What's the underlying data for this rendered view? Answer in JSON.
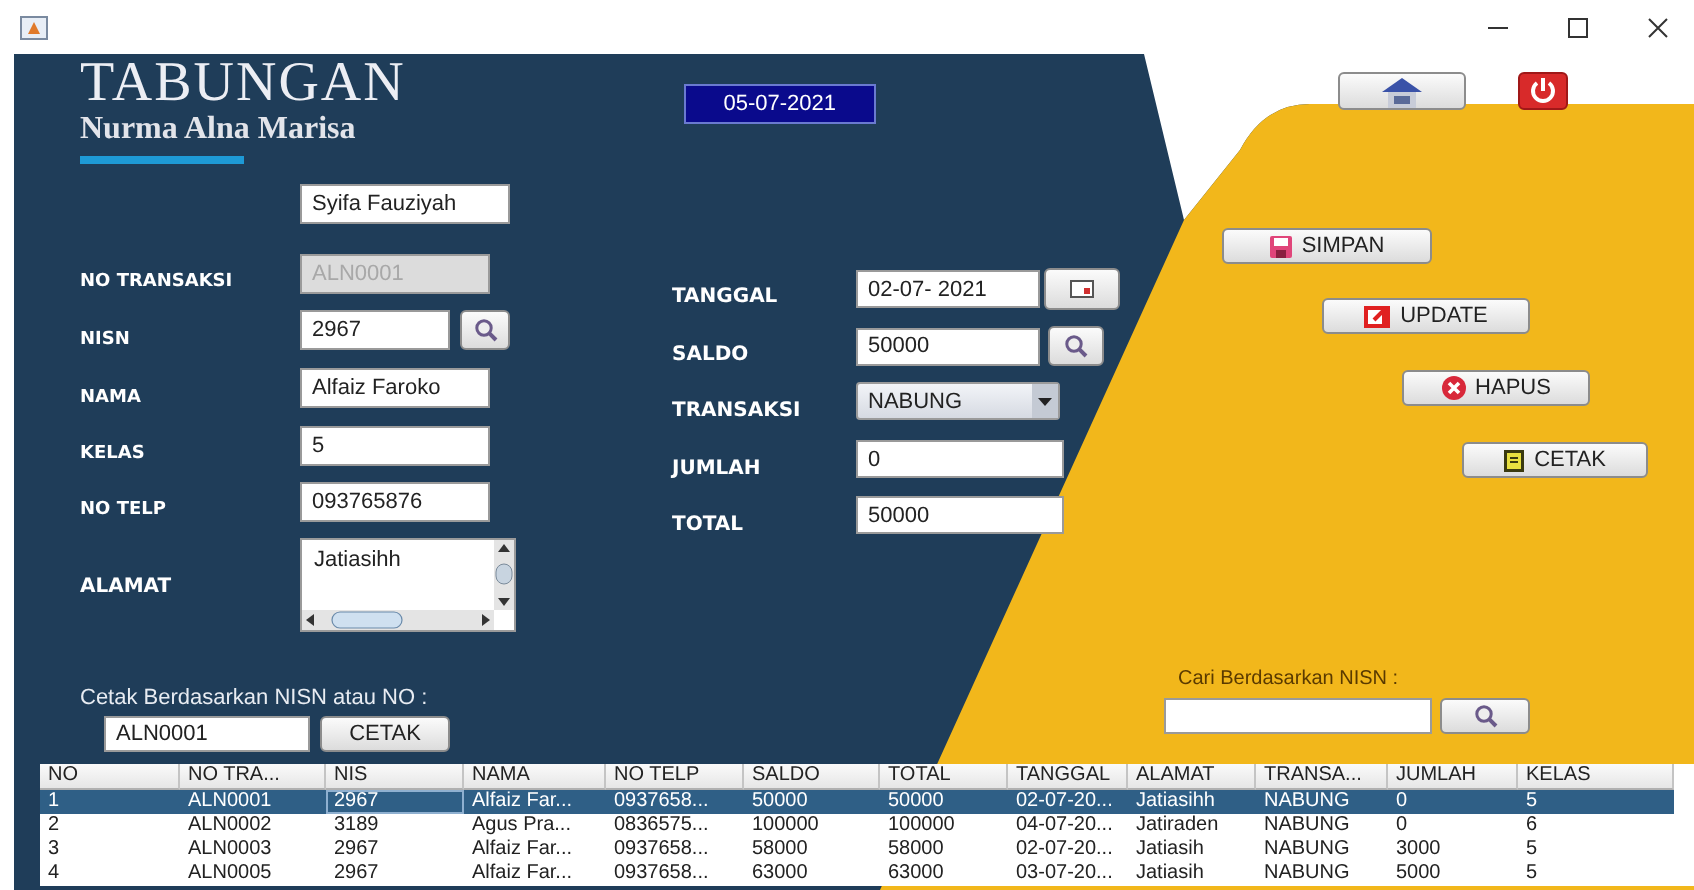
{
  "header": {
    "title": "TABUNGAN",
    "subtitle": "Nurma Alna Marisa",
    "date": "05-07-2021"
  },
  "user_field": {
    "value": "Syifa Fauziyah"
  },
  "student_fields": [
    {
      "label": "NO TRANSAKSI",
      "value": "ALN0001",
      "kind": "text",
      "disabled": true
    },
    {
      "label": "NISN",
      "value": "2967",
      "kind": "search",
      "disabled": false
    },
    {
      "label": "NAMA",
      "value": "Alfaiz Faroko",
      "kind": "text",
      "disabled": false
    },
    {
      "label": "KELAS",
      "value": "5",
      "kind": "text",
      "disabled": false
    },
    {
      "label": "NO TELP",
      "value": "093765876",
      "kind": "text",
      "disabled": false
    },
    {
      "label": "ALAMAT",
      "value": "Jatiasihh",
      "kind": "textarea",
      "disabled": false
    }
  ],
  "transaction_fields": [
    {
      "label": "TANGGAL",
      "value": "02-07- 2021",
      "kind": "date"
    },
    {
      "label": "SALDO",
      "value": "50000",
      "kind": "search"
    },
    {
      "label": "TRANSAKSI",
      "value": "NABUNG",
      "kind": "combo"
    },
    {
      "label": "JUMLAH",
      "value": "0",
      "kind": "text"
    },
    {
      "label": "TOTAL",
      "value": "50000",
      "kind": "text"
    }
  ],
  "actions": [
    {
      "label": "SIMPAN",
      "kind": "save"
    },
    {
      "label": "UPDATE",
      "kind": "edit"
    },
    {
      "label": "HAPUS",
      "kind": "delete"
    },
    {
      "label": "CETAK",
      "kind": "print"
    }
  ],
  "print_by": {
    "label": "Cetak Berdasarkan NISN atau NO :",
    "value": "ALN0001",
    "button": "CETAK"
  },
  "search_by": {
    "label": "Cari Berdasarkan NISN :"
  },
  "table": {
    "columns": [
      "NO",
      "NO TRA...",
      "NIS",
      "NAMA",
      "NO TELP",
      "SALDO",
      "TOTAL",
      "TANGGAL",
      "ALAMAT",
      "TRANSA...",
      "JUMLAH",
      "KELAS"
    ],
    "rows": [
      {
        "selected": true,
        "cells": [
          "1",
          "ALN0001",
          "2967",
          "Alfaiz Far...",
          "0937658...",
          "50000",
          "50000",
          "02-07-20...",
          "Jatiasihh",
          "NABUNG",
          "0",
          "5"
        ]
      },
      {
        "selected": false,
        "cells": [
          "2",
          "ALN0002",
          "3189",
          "Agus Pra...",
          "0836575...",
          "100000",
          "100000",
          "04-07-20...",
          "Jatiraden",
          "NABUNG",
          "0",
          "6"
        ]
      },
      {
        "selected": false,
        "cells": [
          "3",
          "ALN0003",
          "2967",
          "Alfaiz Far...",
          "0937658...",
          "58000",
          "58000",
          "02-07-20...",
          "Jatiasih",
          "NABUNG",
          "3000",
          "5"
        ]
      },
      {
        "selected": false,
        "cells": [
          "4",
          "ALN0005",
          "2967",
          "Alfaiz Far...",
          "0937658...",
          "63000",
          "63000",
          "03-07-20...",
          "Jatiasih",
          "NABUNG",
          "5000",
          "5"
        ]
      }
    ]
  }
}
